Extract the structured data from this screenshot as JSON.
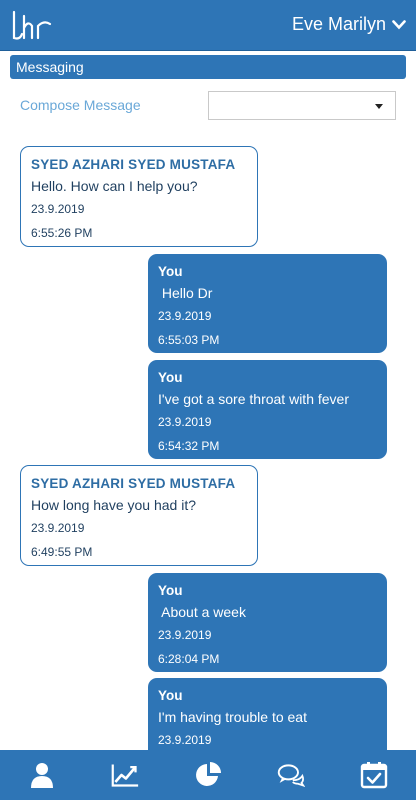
{
  "header": {
    "logo_text": "lhr",
    "user_name": "Eve Marilyn"
  },
  "section": {
    "title": "Messaging"
  },
  "compose": {
    "label": "Compose Message",
    "selected": ""
  },
  "messages": [
    {
      "direction": "in",
      "sender": "SYED AZHARI SYED MUSTAFA",
      "text": "Hello. How can I help you?",
      "date": "23.9.2019",
      "time": "6:55:26 PM"
    },
    {
      "direction": "out",
      "sender": "You",
      "text": " Hello Dr",
      "date": "23.9.2019",
      "time": "6:55:03 PM"
    },
    {
      "direction": "out",
      "sender": "You",
      "text": "I've got a sore throat with fever",
      "date": "23.9.2019",
      "time": "6:54:32 PM"
    },
    {
      "direction": "in",
      "sender": "SYED AZHARI SYED MUSTAFA",
      "text": "How long have you had it?",
      "date": "23.9.2019",
      "time": "6:49:55 PM"
    },
    {
      "direction": "out",
      "sender": "You",
      "text": " About a week",
      "date": "23.9.2019",
      "time": "6:28:04 PM"
    },
    {
      "direction": "out",
      "sender": "You",
      "text": "I'm having trouble to eat",
      "date": "23.9.2019",
      "time": ""
    }
  ],
  "nav": {
    "items": [
      {
        "icon": "profile-icon"
      },
      {
        "icon": "chart-icon"
      },
      {
        "icon": "pie-chart-icon"
      },
      {
        "icon": "messages-icon"
      },
      {
        "icon": "calendar-check-icon"
      }
    ]
  }
}
